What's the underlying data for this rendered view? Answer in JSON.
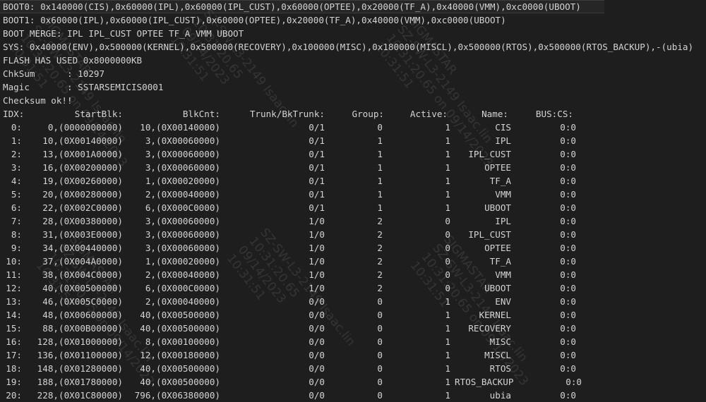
{
  "lines": [
    "BOOT0: 0x140000(CIS),0x60000(IPL),0x60000(IPL_CUST),0x60000(OPTEE),0x20000(TF_A),0x40000(VMM),0xc0000(UBOOT)",
    "BOOT1: 0x60000(IPL),0x60000(IPL_CUST),0x60000(OPTEE),0x20000(TF_A),0x40000(VMM),0xc0000(UBOOT)",
    "BOOT MERGE: IPL IPL_CUST OPTEE TF_A VMM UBOOT",
    "SYS: 0x40000(ENV),0x500000(KERNEL),0x500000(RECOVERY),0x100000(MISC),0x180000(MISCL),0x500000(RTOS),0x500000(RTOS_BACKUP),-(ubia)",
    "FLASH HAS USED 0x8000000KB",
    "ChkSum      : 10297",
    "Magic       : SSTARSEMICIS0001",
    "Checksum ok!!"
  ],
  "table": {
    "headers": {
      "idx": "IDX:",
      "startblk": "StartBlk:",
      "blkcnt": "BlkCnt:",
      "trunk": "Trunk/BkTrunk:",
      "group": "Group:",
      "active": "Active:",
      "name": "Name:",
      "buscs": "BUS:CS:"
    },
    "rows": [
      {
        "idx": "0:",
        "startblk": "0,(0000000000)",
        "blkcnt": "10,(0X00140000)",
        "trunk": "0/1",
        "group": "0",
        "active": "1",
        "name": "CIS",
        "buscs": "0:0"
      },
      {
        "idx": "1:",
        "startblk": "10,(0X00140000)",
        "blkcnt": "3,(0X00060000)",
        "trunk": "0/1",
        "group": "1",
        "active": "1",
        "name": "IPL",
        "buscs": "0:0"
      },
      {
        "idx": "2:",
        "startblk": "13,(0X001A0000)",
        "blkcnt": "3,(0X00060000)",
        "trunk": "0/1",
        "group": "1",
        "active": "1",
        "name": "IPL_CUST",
        "buscs": "0:0"
      },
      {
        "idx": "3:",
        "startblk": "16,(0X00200000)",
        "blkcnt": "3,(0X00060000)",
        "trunk": "0/1",
        "group": "1",
        "active": "1",
        "name": "OPTEE",
        "buscs": "0:0"
      },
      {
        "idx": "4:",
        "startblk": "19,(0X00260000)",
        "blkcnt": "1,(0X00020000)",
        "trunk": "0/1",
        "group": "1",
        "active": "1",
        "name": "TF_A",
        "buscs": "0:0"
      },
      {
        "idx": "5:",
        "startblk": "20,(0X00280000)",
        "blkcnt": "2,(0X00040000)",
        "trunk": "0/1",
        "group": "1",
        "active": "1",
        "name": "VMM",
        "buscs": "0:0"
      },
      {
        "idx": "6:",
        "startblk": "22,(0X002C0000)",
        "blkcnt": "6,(0X000C0000)",
        "trunk": "0/1",
        "group": "1",
        "active": "1",
        "name": "UBOOT",
        "buscs": "0:0"
      },
      {
        "idx": "7:",
        "startblk": "28,(0X00380000)",
        "blkcnt": "3,(0X00060000)",
        "trunk": "1/0",
        "group": "2",
        "active": "0",
        "name": "IPL",
        "buscs": "0:0"
      },
      {
        "idx": "8:",
        "startblk": "31,(0X003E0000)",
        "blkcnt": "3,(0X00060000)",
        "trunk": "1/0",
        "group": "2",
        "active": "0",
        "name": "IPL_CUST",
        "buscs": "0:0"
      },
      {
        "idx": "9:",
        "startblk": "34,(0X00440000)",
        "blkcnt": "3,(0X00060000)",
        "trunk": "1/0",
        "group": "2",
        "active": "0",
        "name": "OPTEE",
        "buscs": "0:0"
      },
      {
        "idx": "10:",
        "startblk": "37,(0X004A0000)",
        "blkcnt": "1,(0X00020000)",
        "trunk": "1/0",
        "group": "2",
        "active": "0",
        "name": "TF_A",
        "buscs": "0:0"
      },
      {
        "idx": "11:",
        "startblk": "38,(0X004C0000)",
        "blkcnt": "2,(0X00040000)",
        "trunk": "1/0",
        "group": "2",
        "active": "0",
        "name": "VMM",
        "buscs": "0:0"
      },
      {
        "idx": "12:",
        "startblk": "40,(0X00500000)",
        "blkcnt": "6,(0X000C0000)",
        "trunk": "1/0",
        "group": "2",
        "active": "0",
        "name": "UBOOT",
        "buscs": "0:0"
      },
      {
        "idx": "13:",
        "startblk": "46,(0X005C0000)",
        "blkcnt": "2,(0X00040000)",
        "trunk": "0/0",
        "group": "0",
        "active": "1",
        "name": "ENV",
        "buscs": "0:0"
      },
      {
        "idx": "14:",
        "startblk": "48,(0X00600000)",
        "blkcnt": "40,(0X00500000)",
        "trunk": "0/0",
        "group": "0",
        "active": "1",
        "name": "KERNEL",
        "buscs": "0:0"
      },
      {
        "idx": "15:",
        "startblk": "88,(0X00B00000)",
        "blkcnt": "40,(0X00500000)",
        "trunk": "0/0",
        "group": "0",
        "active": "1",
        "name": "RECOVERY",
        "buscs": "0:0"
      },
      {
        "idx": "16:",
        "startblk": "128,(0X01000000)",
        "blkcnt": "8,(0X00100000)",
        "trunk": "0/0",
        "group": "0",
        "active": "1",
        "name": "MISC",
        "buscs": "0:0"
      },
      {
        "idx": "17:",
        "startblk": "136,(0X01100000)",
        "blkcnt": "12,(0X00180000)",
        "trunk": "0/0",
        "group": "0",
        "active": "1",
        "name": "MISCL",
        "buscs": "0:0"
      },
      {
        "idx": "18:",
        "startblk": "148,(0X01280000)",
        "blkcnt": "40,(0X00500000)",
        "trunk": "0/0",
        "group": "0",
        "active": "1",
        "name": "RTOS",
        "buscs": "0:0"
      },
      {
        "idx": "19:",
        "startblk": "188,(0X01780000)",
        "blkcnt": "40,(0X00500000)",
        "trunk": "0/0",
        "group": "0",
        "active": "1",
        "name": "RTOS_BACKUP",
        "buscs": "0:0"
      },
      {
        "idx": "20:",
        "startblk": "228,(0X01C80000)",
        "blkcnt": "796,(0X06380000)",
        "trunk": "0/0",
        "group": "0",
        "active": "1",
        "name": "ubia",
        "buscs": "0:0"
      }
    ]
  },
  "watermarks": [
    "SZ-SW-L3-2149 Isaac.lin\n10:31:20.65\n09/14/2023\n10:31:51",
    "SIGMASTAR\nSZ-SW-L3-2149 Isaac.lin\n10:31:20.65 on 09/14/2023\n10:31:51"
  ]
}
